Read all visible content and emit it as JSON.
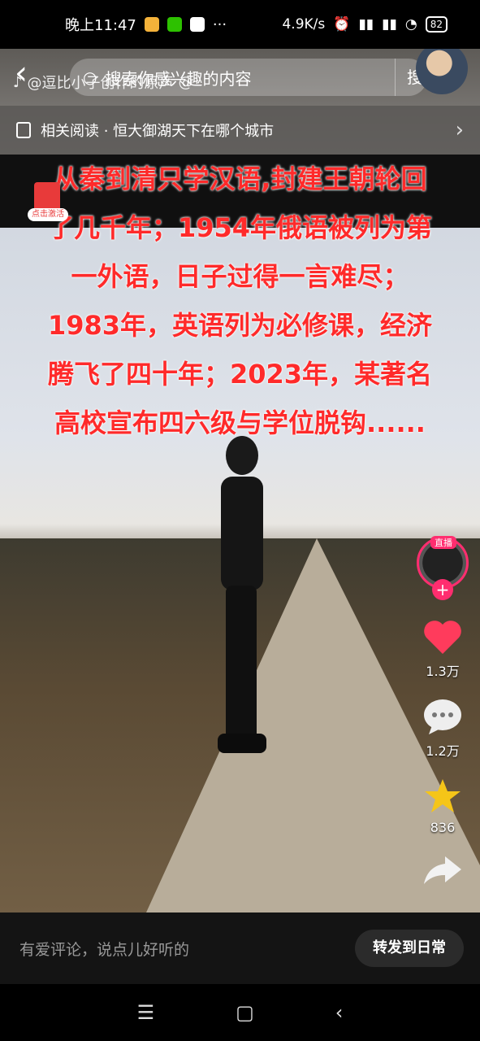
{
  "status_bar": {
    "time": "晚上11:47",
    "dots": "···",
    "net_speed": "4.9K/s",
    "battery": "82"
  },
  "top": {
    "search_placeholder": "搜索你感兴趣的内容",
    "search_button": "搜索",
    "author": "@逗比小子创作的原声",
    "author_suffix": "@"
  },
  "related": {
    "label": "相关阅读 · 恒大御湖天下在哪个城市"
  },
  "headline": {
    "lines": [
      "从秦到清只学汉语,封建王朝轮回",
      "了几千年；1954年俄语被列为第",
      "一外语，日子过得一言难尽；",
      "1983年，英语列为必修课，经济",
      "腾飞了四十年；2023年，某著名",
      "高校宣布四六级与学位脱钩......"
    ]
  },
  "redpack": {
    "tag": "点击激活"
  },
  "rail": {
    "live_tag": "直播",
    "plus": "+",
    "likes": "1.3万",
    "comments": "1.2万",
    "favorites": "836"
  },
  "comment_bar": {
    "placeholder": "有爱评论，说点儿好听的",
    "share_button": "转发到日常"
  },
  "colors": {
    "headline_red": "#ff2a2a",
    "like_pink": "#ff3b5c",
    "star_yellow": "#f5c518",
    "live_pink": "#ff2d6f"
  }
}
